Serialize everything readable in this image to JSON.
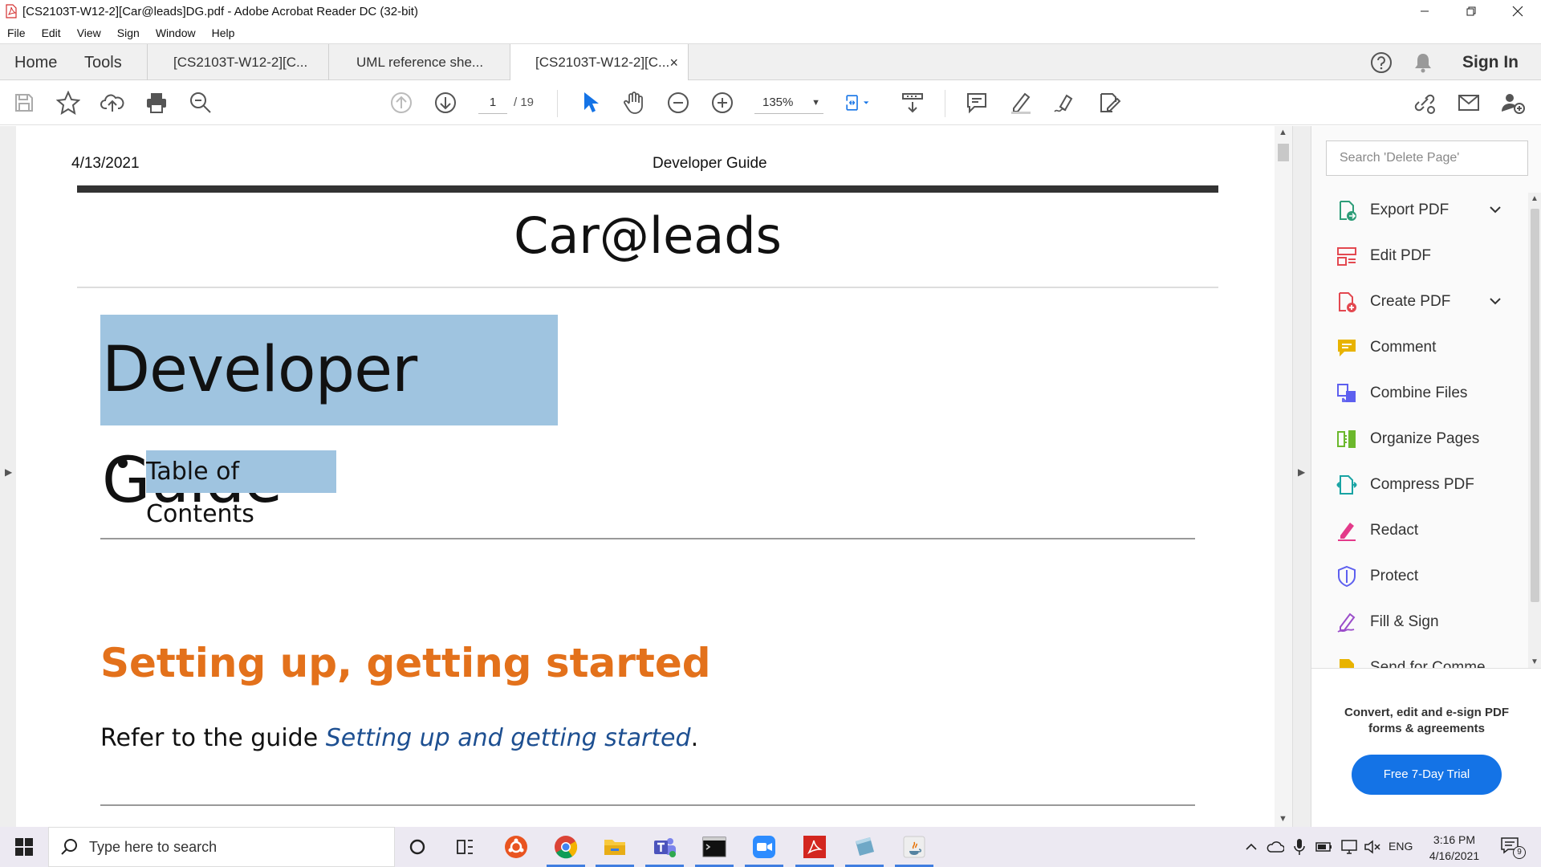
{
  "window": {
    "title": "[CS2103T-W12-2][Car@leads]DG.pdf - Adobe Acrobat Reader DC (32-bit)"
  },
  "menu": [
    "File",
    "Edit",
    "View",
    "Sign",
    "Window",
    "Help"
  ],
  "tabs": {
    "home": "Home",
    "tools": "Tools",
    "docs": [
      {
        "label": "[CS2103T-W12-2][C...",
        "active": false
      },
      {
        "label": "UML reference she...",
        "active": false
      },
      {
        "label": "[CS2103T-W12-2][C...",
        "active": true
      }
    ],
    "close": "×",
    "sign_in": "Sign In"
  },
  "toolbar": {
    "page_current": "1",
    "page_total": "/ 19",
    "zoom": "135%"
  },
  "document": {
    "date": "4/13/2021",
    "header": "Developer Guide",
    "app_title": "Car@leads",
    "heading": "Developer Guide",
    "toc_item": "Table of Contents",
    "section_heading": "Setting up, getting started",
    "refer_prefix": "Refer to the guide ",
    "refer_link": "Setting up and getting started",
    "refer_suffix": "."
  },
  "right_panel": {
    "search_placeholder": "Search 'Delete Page'",
    "tools": [
      {
        "label": "Export PDF",
        "icon": "export-pdf-icon",
        "color": "#2d9d78",
        "expandable": true
      },
      {
        "label": "Edit PDF",
        "icon": "edit-pdf-icon",
        "color": "#e34850",
        "expandable": false
      },
      {
        "label": "Create PDF",
        "icon": "create-pdf-icon",
        "color": "#e34850",
        "expandable": true
      },
      {
        "label": "Comment",
        "icon": "comment-icon",
        "color": "#e8b300",
        "expandable": false
      },
      {
        "label": "Combine Files",
        "icon": "combine-files-icon",
        "color": "#5d5fef",
        "expandable": false
      },
      {
        "label": "Organize Pages",
        "icon": "organize-pages-icon",
        "color": "#6bb82c",
        "expandable": false
      },
      {
        "label": "Compress PDF",
        "icon": "compress-pdf-icon",
        "color": "#18a3a3",
        "expandable": false
      },
      {
        "label": "Redact",
        "icon": "redact-icon",
        "color": "#e33a8a",
        "expandable": false
      },
      {
        "label": "Protect",
        "icon": "protect-icon",
        "color": "#5d5fef",
        "expandable": false
      },
      {
        "label": "Fill & Sign",
        "icon": "fill-sign-icon",
        "color": "#9b4dca",
        "expandable": false
      },
      {
        "label": "Send for Comme",
        "icon": "send-for-comment-icon",
        "color": "#e8b300",
        "expandable": false
      }
    ],
    "promo_text": "Convert, edit and e-sign PDF forms & agreements",
    "trial_button": "Free 7-Day Trial"
  },
  "taskbar": {
    "search_placeholder": "Type here to search",
    "language": "ENG",
    "time": "3:16 PM",
    "date": "4/16/2021",
    "notifications": "9"
  },
  "colors": {
    "accent": "#1473e6",
    "selection": "#9fc4e0",
    "heading_orange": "#e3711b",
    "link_blue": "#1d4f91"
  }
}
